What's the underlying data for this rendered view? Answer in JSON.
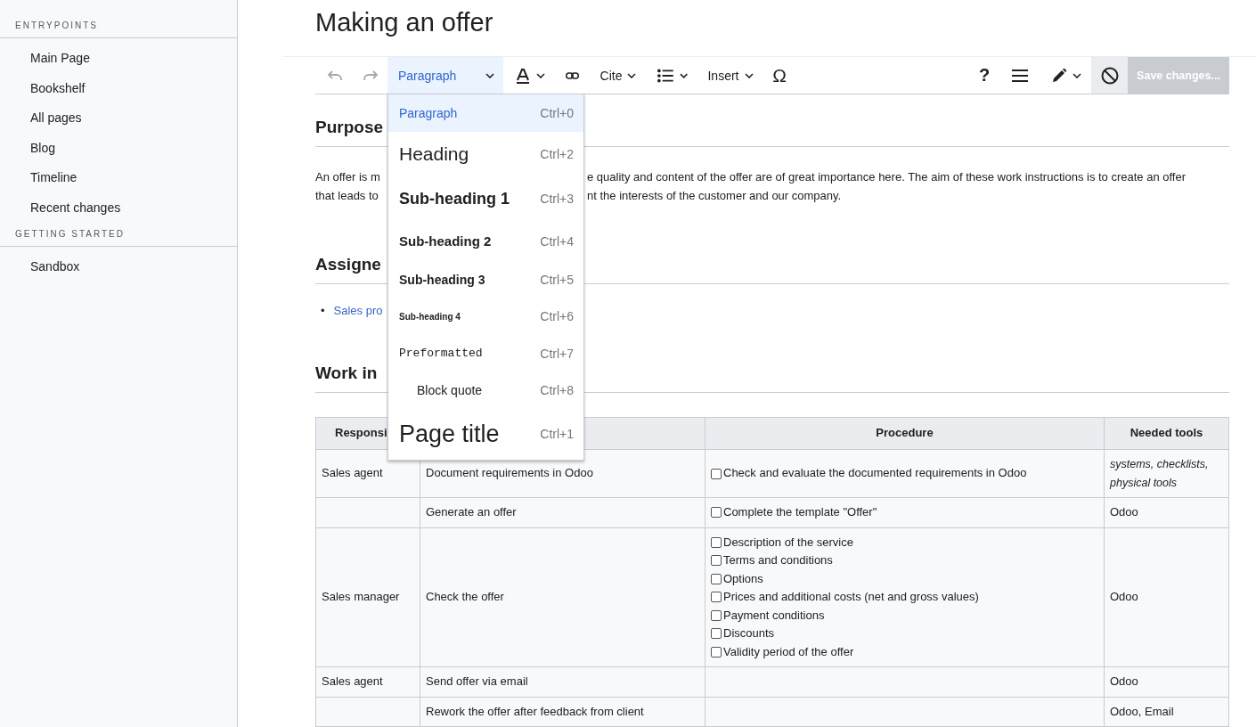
{
  "sidebar": {
    "sections": [
      {
        "heading": "ENTRYPOINTS",
        "items": [
          "Main Page",
          "Bookshelf",
          "All pages",
          "Blog",
          "Timeline",
          "Recent changes"
        ]
      },
      {
        "heading": "GETTING STARTED",
        "items": [
          "Sandbox"
        ]
      }
    ]
  },
  "page": {
    "title": "Making an offer"
  },
  "toolbar": {
    "undo": {
      "disabled": true
    },
    "redo": {
      "disabled": true
    },
    "format_menu": "Paragraph",
    "cite": "Cite",
    "insert": "Insert",
    "special_character": "Ω",
    "help": "?",
    "save": {
      "label": "Save changes...",
      "disabled": true
    }
  },
  "format_dropdown": {
    "items": [
      {
        "kind": "paragraph",
        "label": "Paragraph",
        "shortcut": "Ctrl+0",
        "selected": true
      },
      {
        "kind": "heading",
        "label": "Heading",
        "shortcut": "Ctrl+2",
        "selected": false
      },
      {
        "kind": "sub1",
        "label": "Sub-heading 1",
        "shortcut": "Ctrl+3",
        "selected": false
      },
      {
        "kind": "sub2",
        "label": "Sub-heading 2",
        "shortcut": "Ctrl+4",
        "selected": false
      },
      {
        "kind": "sub3",
        "label": "Sub-heading 3",
        "shortcut": "Ctrl+5",
        "selected": false
      },
      {
        "kind": "sub4",
        "label": "Sub-heading 4",
        "shortcut": "Ctrl+6",
        "selected": false
      },
      {
        "kind": "pre",
        "label": "Preformatted",
        "shortcut": "Ctrl+7",
        "selected": false
      },
      {
        "kind": "quote",
        "label": "Block quote",
        "shortcut": "Ctrl+8",
        "selected": false
      },
      {
        "kind": "title",
        "label": "Page title",
        "shortcut": "Ctrl+1",
        "selected": false
      }
    ]
  },
  "sections": [
    {
      "heading": "Purpose",
      "paragraph_lines": [
        {
          "left": "An offer is m",
          "right": "e quality and content of the offer are of great importance here. The aim of these work instructions is to create an offer"
        },
        {
          "left": "that leads to",
          "right": "nt the interests of the customer and our company."
        }
      ]
    },
    {
      "heading": "Assigne",
      "links": [
        {
          "bullet": "•",
          "label": "Sales pro"
        }
      ]
    },
    {
      "heading": "Work in",
      "table": {
        "header": {
          "column_1": "Responsi",
          "procedure": "Procedure",
          "needed_tools": "Needed tools"
        },
        "rows": [
          {
            "responsible": "Sales agent",
            "step": "Document requirements in Odoo",
            "procedure": [
              {
                "label": "Check and evaluate the documented requirements in Odoo",
                "checked": false
              }
            ],
            "tools": {
              "text": "systems, checklists, physical tools",
              "kind": "hint"
            }
          },
          {
            "step": "Generate an offer",
            "procedure": [
              {
                "label": "Complete the template \"Offer\"",
                "checked": false
              }
            ],
            "tools": {
              "text": "Odoo",
              "kind": "plain"
            }
          },
          {
            "responsible": "Sales manager",
            "step": "Check the offer",
            "procedure": [
              {
                "label": "Description of the service",
                "checked": false
              },
              {
                "label": "Terms and conditions",
                "checked": false
              },
              {
                "label": "Options",
                "checked": false
              },
              {
                "label": "Prices and additional costs (net and gross values)",
                "checked": false
              },
              {
                "label": "Payment conditions",
                "checked": false
              },
              {
                "label": "Discounts",
                "checked": false
              },
              {
                "label": "Validity period of the offer",
                "checked": false
              }
            ],
            "tools": {
              "text": "Odoo",
              "kind": "plain"
            }
          },
          {
            "responsible": "Sales agent",
            "step": "Send offer via email",
            "tools": {
              "text": "Odoo",
              "kind": "plain"
            }
          },
          {
            "step": "Rework the offer after feedback from client",
            "tools": {
              "text": "Odoo, Email",
              "kind": "plain"
            }
          }
        ]
      }
    }
  ]
}
